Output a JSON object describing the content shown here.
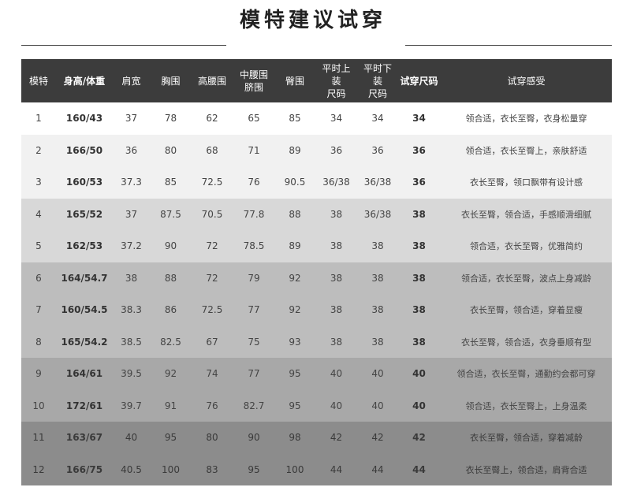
{
  "title": "模特建议试穿",
  "headers": {
    "model": "模特",
    "height_weight": "身高/体重",
    "shoulder": "肩宽",
    "bust": "胸围",
    "high_waist": "高腰围",
    "mid_waist_l1": "中腰围",
    "mid_waist_l2": "脐围",
    "hip": "臀围",
    "top_l1": "平时上",
    "top_l2": "装",
    "top_l3": "尺码",
    "bottom_l1": "平时下",
    "bottom_l2": "装",
    "bottom_l3": "尺码",
    "try_size": "试穿尺码",
    "feel": "试穿感受"
  },
  "rows": [
    {
      "model": "1",
      "hw": "160/43",
      "shoulder": "37",
      "bust": "78",
      "high_waist": "62",
      "mid_waist": "65",
      "hip": "85",
      "top": "34",
      "bottom": "34",
      "size": "34",
      "feel": "领合适，衣长至臀，衣身松量穿"
    },
    {
      "model": "2",
      "hw": "166/50",
      "shoulder": "36",
      "bust": "80",
      "high_waist": "68",
      "mid_waist": "71",
      "hip": "89",
      "top": "36",
      "bottom": "36",
      "size": "36",
      "feel": "领合适，衣长至臀上，亲肤舒适"
    },
    {
      "model": "3",
      "hw": "160/53",
      "shoulder": "37.3",
      "bust": "85",
      "high_waist": "72.5",
      "mid_waist": "76",
      "hip": "90.5",
      "top": "36/38",
      "bottom": "36/38",
      "size": "36",
      "feel": "衣长至臀，领口飘带有设计感"
    },
    {
      "model": "4",
      "hw": "165/52",
      "shoulder": "37",
      "bust": "87.5",
      "high_waist": "70.5",
      "mid_waist": "77.8",
      "hip": "88",
      "top": "38",
      "bottom": "36/38",
      "size": "38",
      "feel": "衣长至臀，领合适，手感顺滑细腻"
    },
    {
      "model": "5",
      "hw": "162/53",
      "shoulder": "37.2",
      "bust": "90",
      "high_waist": "72",
      "mid_waist": "78.5",
      "hip": "89",
      "top": "38",
      "bottom": "38",
      "size": "38",
      "feel": "领合适，衣长至臀，优雅简约"
    },
    {
      "model": "6",
      "hw": "164/54.7",
      "shoulder": "38",
      "bust": "88",
      "high_waist": "72",
      "mid_waist": "79",
      "hip": "92",
      "top": "38",
      "bottom": "38",
      "size": "38",
      "feel": "领合适，衣长至臀，波点上身减龄"
    },
    {
      "model": "7",
      "hw": "160/54.5",
      "shoulder": "38.3",
      "bust": "86",
      "high_waist": "72.5",
      "mid_waist": "77",
      "hip": "92",
      "top": "38",
      "bottom": "38",
      "size": "38",
      "feel": "衣长至臀，领合适，穿着显瘦"
    },
    {
      "model": "8",
      "hw": "165/54.2",
      "shoulder": "38.5",
      "bust": "82.5",
      "high_waist": "67",
      "mid_waist": "75",
      "hip": "93",
      "top": "38",
      "bottom": "38",
      "size": "38",
      "feel": "衣长至臀，领合适，衣身垂顺有型"
    },
    {
      "model": "9",
      "hw": "164/61",
      "shoulder": "39.5",
      "bust": "92",
      "high_waist": "74",
      "mid_waist": "77",
      "hip": "95",
      "top": "40",
      "bottom": "40",
      "size": "40",
      "feel": "领合适，衣长至臀，通勤约会都可穿"
    },
    {
      "model": "10",
      "hw": "172/61",
      "shoulder": "39.7",
      "bust": "91",
      "high_waist": "76",
      "mid_waist": "82.7",
      "hip": "95",
      "top": "40",
      "bottom": "40",
      "size": "40",
      "feel": "领合适，衣长至臀上，上身温柔"
    },
    {
      "model": "11",
      "hw": "163/67",
      "shoulder": "40",
      "bust": "95",
      "high_waist": "80",
      "mid_waist": "90",
      "hip": "98",
      "top": "42",
      "bottom": "42",
      "size": "42",
      "feel": "衣长至臀，领合适，穿着减龄"
    },
    {
      "model": "12",
      "hw": "166/75",
      "shoulder": "40.5",
      "bust": "100",
      "high_waist": "83",
      "mid_waist": "95",
      "hip": "100",
      "top": "44",
      "bottom": "44",
      "size": "44",
      "feel": "衣长至臀上，领合适，肩背合适"
    }
  ],
  "colors": {
    "header_bg": "#3c3c3c",
    "band_white": "#ffffff",
    "band_light": "#f1f1f1",
    "band_mid": "#d8d8d8",
    "band_grey": "#bdbdbd",
    "band_dark": "#a8a8a8",
    "band_darkest": "#8c8c8c"
  }
}
